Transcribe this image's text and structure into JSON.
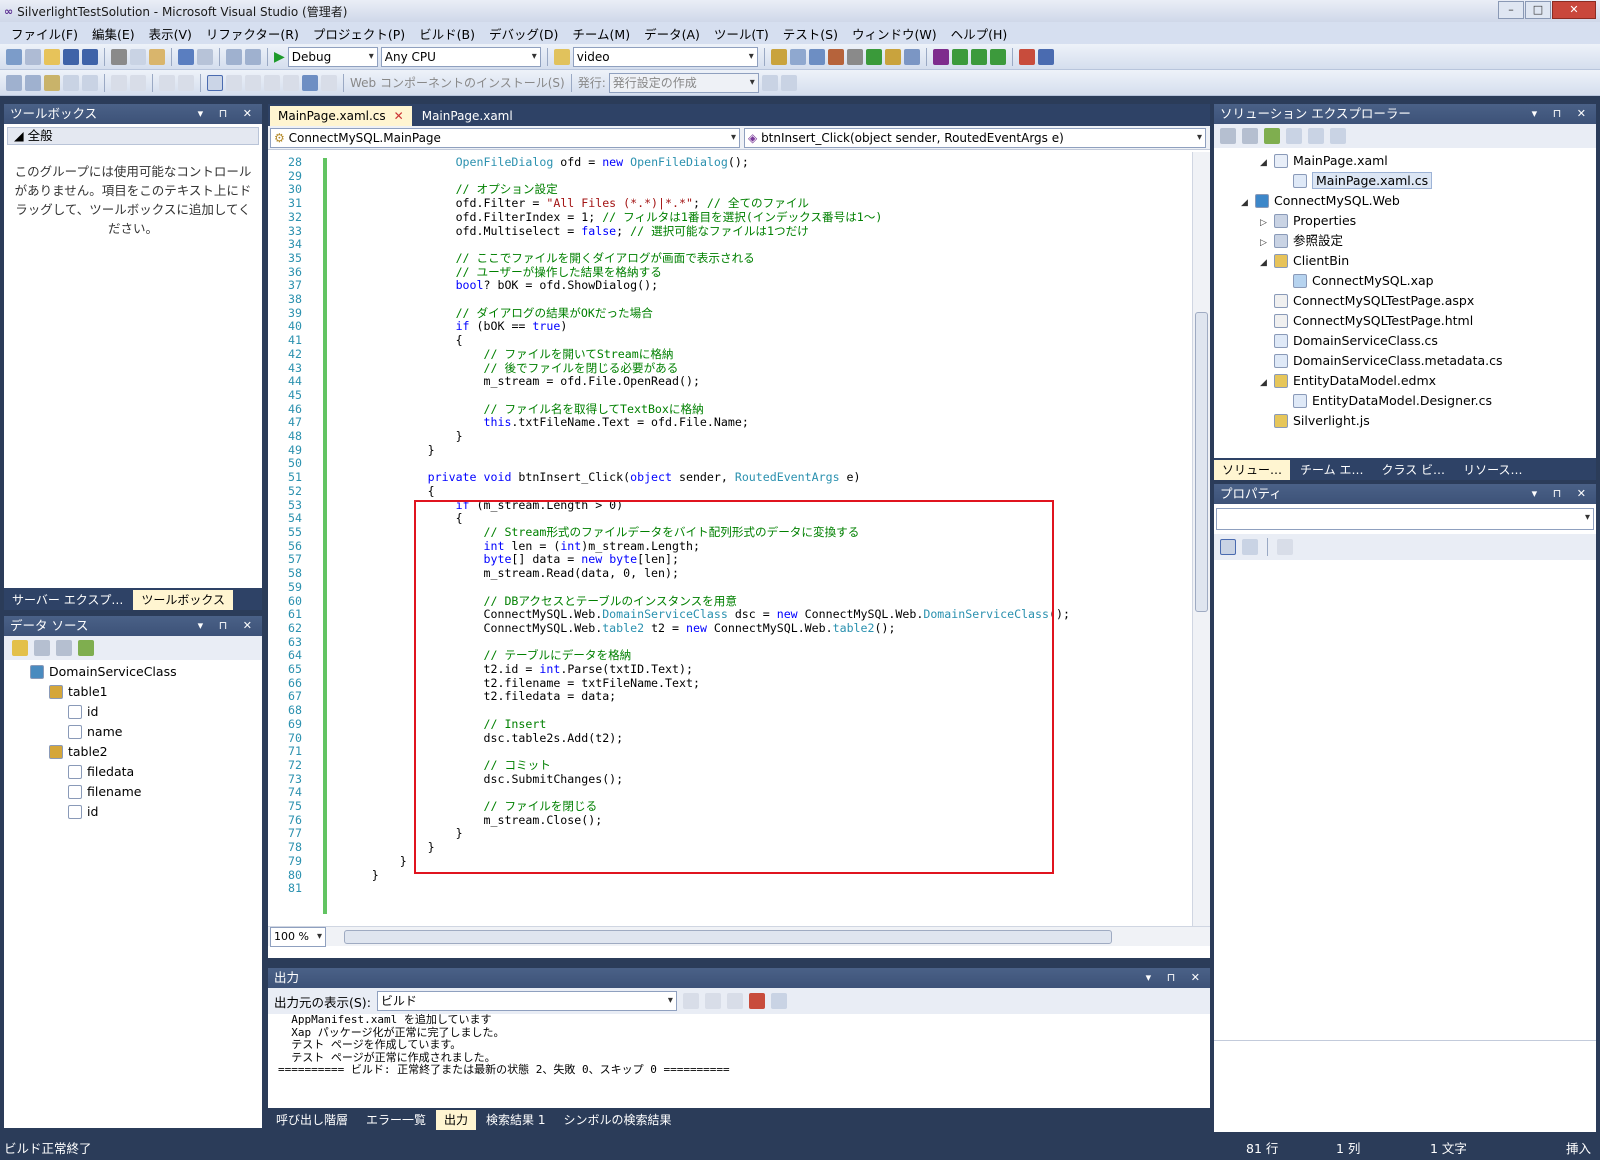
{
  "window": {
    "title": "SilverlightTestSolution - Microsoft Visual Studio (管理者)",
    "minimize": "–",
    "maximize": "□",
    "close": "✕"
  },
  "menu": [
    "ファイル(F)",
    "編集(E)",
    "表示(V)",
    "リファクター(R)",
    "プロジェクト(P)",
    "ビルド(B)",
    "デバッグ(D)",
    "チーム(M)",
    "データ(A)",
    "ツール(T)",
    "テスト(S)",
    "ウィンドウ(W)",
    "ヘルプ(H)"
  ],
  "toolbar": {
    "config": "Debug",
    "platform": "Any CPU",
    "find": "video",
    "web_install": "Web コンポーネントのインストール(S)",
    "publish_label": "発行:",
    "publish_value": "発行設定の作成"
  },
  "toolbox": {
    "title": "ツールボックス",
    "group": "全般",
    "message": "このグループには使用可能なコントロールがありません。項目をこのテキスト上にドラッグして、ツールボックスに追加してください。",
    "tabs": [
      "サーバー エクスプ…",
      "ツールボックス"
    ]
  },
  "datasource": {
    "title": "データ ソース",
    "items": [
      {
        "label": "DomainServiceClass",
        "level": 0,
        "icon": "database-icon"
      },
      {
        "label": "table1",
        "level": 1,
        "icon": "table-icon"
      },
      {
        "label": "id",
        "level": 2,
        "icon": "numeric-field-icon"
      },
      {
        "label": "name",
        "level": 2,
        "icon": "text-field-icon"
      },
      {
        "label": "table2",
        "level": 1,
        "icon": "table-icon"
      },
      {
        "label": "filedata",
        "level": 2,
        "icon": "binary-field-icon"
      },
      {
        "label": "filename",
        "level": 2,
        "icon": "text-field-icon"
      },
      {
        "label": "id",
        "level": 2,
        "icon": "numeric-field-icon"
      }
    ]
  },
  "editor": {
    "tabs": [
      {
        "label": "MainPage.xaml.cs",
        "active": true
      },
      {
        "label": "MainPage.xaml",
        "active": false
      }
    ],
    "class_combo": "ConnectMySQL.MainPage",
    "method_combo": "btnInsert_Click(object sender, RoutedEventArgs e)",
    "zoom": "100 %",
    "lines": [
      {
        "n": "28",
        "h": "                OpenFileDialog ofd = new OpenFileDialog();"
      },
      {
        "n": "29",
        "h": ""
      },
      {
        "n": "30",
        "h": "                // オプション設定"
      },
      {
        "n": "31",
        "h": "                ofd.Filter = \"All Files (*.*)|*.*\"; // 全てのファイル"
      },
      {
        "n": "32",
        "h": "                ofd.FilterIndex = 1; // フィルタは1番目を選択(インデックス番号は1～)"
      },
      {
        "n": "33",
        "h": "                ofd.Multiselect = false; // 選択可能なファイルは1つだけ"
      },
      {
        "n": "34",
        "h": ""
      },
      {
        "n": "35",
        "h": "                // ここでファイルを開くダイアログが画面で表示される"
      },
      {
        "n": "36",
        "h": "                // ユーザーが操作した結果を格納する"
      },
      {
        "n": "37",
        "h": "                bool? bOK = ofd.ShowDialog();"
      },
      {
        "n": "38",
        "h": ""
      },
      {
        "n": "39",
        "h": "                // ダイアログの結果がOKだった場合"
      },
      {
        "n": "40",
        "h": "                if (bOK == true)"
      },
      {
        "n": "41",
        "h": "                {"
      },
      {
        "n": "42",
        "h": "                    // ファイルを開いてStreamに格納"
      },
      {
        "n": "43",
        "h": "                    // 後でファイルを閉じる必要がある"
      },
      {
        "n": "44",
        "h": "                    m_stream = ofd.File.OpenRead();"
      },
      {
        "n": "45",
        "h": ""
      },
      {
        "n": "46",
        "h": "                    // ファイル名を取得してTextBoxに格納"
      },
      {
        "n": "47",
        "h": "                    this.txtFileName.Text = ofd.File.Name;"
      },
      {
        "n": "48",
        "h": "                }"
      },
      {
        "n": "49",
        "h": "            }"
      },
      {
        "n": "50",
        "h": ""
      },
      {
        "n": "51",
        "h": "            private void btnInsert_Click(object sender, RoutedEventArgs e)"
      },
      {
        "n": "52",
        "h": "            {"
      },
      {
        "n": "53",
        "h": "                if (m_stream.Length > 0)"
      },
      {
        "n": "54",
        "h": "                {"
      },
      {
        "n": "55",
        "h": "                    // Stream形式のファイルデータをバイト配列形式のデータに変換する"
      },
      {
        "n": "56",
        "h": "                    int len = (int)m_stream.Length;"
      },
      {
        "n": "57",
        "h": "                    byte[] data = new byte[len];"
      },
      {
        "n": "58",
        "h": "                    m_stream.Read(data, 0, len);"
      },
      {
        "n": "59",
        "h": ""
      },
      {
        "n": "60",
        "h": "                    // DBアクセスとテーブルのインスタンスを用意"
      },
      {
        "n": "61",
        "h": "                    ConnectMySQL.Web.DomainServiceClass dsc = new ConnectMySQL.Web.DomainServiceClass();"
      },
      {
        "n": "62",
        "h": "                    ConnectMySQL.Web.table2 t2 = new ConnectMySQL.Web.table2();"
      },
      {
        "n": "63",
        "h": ""
      },
      {
        "n": "64",
        "h": "                    // テーブルにデータを格納"
      },
      {
        "n": "65",
        "h": "                    t2.id = int.Parse(txtID.Text);"
      },
      {
        "n": "66",
        "h": "                    t2.filename = txtFileName.Text;"
      },
      {
        "n": "67",
        "h": "                    t2.filedata = data;"
      },
      {
        "n": "68",
        "h": ""
      },
      {
        "n": "69",
        "h": "                    // Insert"
      },
      {
        "n": "70",
        "h": "                    dsc.table2s.Add(t2);"
      },
      {
        "n": "71",
        "h": ""
      },
      {
        "n": "72",
        "h": "                    // コミット"
      },
      {
        "n": "73",
        "h": "                    dsc.SubmitChanges();"
      },
      {
        "n": "74",
        "h": ""
      },
      {
        "n": "75",
        "h": "                    // ファイルを閉じる"
      },
      {
        "n": "76",
        "h": "                    m_stream.Close();"
      },
      {
        "n": "77",
        "h": "                }"
      },
      {
        "n": "78",
        "h": "            }"
      },
      {
        "n": "79",
        "h": "        }"
      },
      {
        "n": "80",
        "h": "    }"
      },
      {
        "n": "81",
        "h": ""
      }
    ]
  },
  "solution": {
    "title": "ソリューション エクスプローラー",
    "items": [
      {
        "label": "MainPage.xaml",
        "level": 2,
        "exp": "◢",
        "icon": "xaml-file-icon"
      },
      {
        "label": "MainPage.xaml.cs",
        "level": 3,
        "exp": "",
        "icon": "cs-file-icon",
        "sel": true
      },
      {
        "label": "ConnectMySQL.Web",
        "level": 1,
        "exp": "◢",
        "icon": "web-project-icon"
      },
      {
        "label": "Properties",
        "level": 2,
        "exp": "▷",
        "icon": "properties-icon"
      },
      {
        "label": "参照設定",
        "level": 2,
        "exp": "▷",
        "icon": "references-icon"
      },
      {
        "label": "ClientBin",
        "level": 2,
        "exp": "◢",
        "icon": "folder-icon"
      },
      {
        "label": "ConnectMySQL.xap",
        "level": 3,
        "exp": "",
        "icon": "xap-file-icon"
      },
      {
        "label": "ConnectMySQLTestPage.aspx",
        "level": 2,
        "exp": "",
        "icon": "aspx-file-icon"
      },
      {
        "label": "ConnectMySQLTestPage.html",
        "level": 2,
        "exp": "",
        "icon": "html-file-icon"
      },
      {
        "label": "DomainServiceClass.cs",
        "level": 2,
        "exp": "",
        "icon": "cs-file-icon"
      },
      {
        "label": "DomainServiceClass.metadata.cs",
        "level": 2,
        "exp": "",
        "icon": "cs-file-icon"
      },
      {
        "label": "EntityDataModel.edmx",
        "level": 2,
        "exp": "◢",
        "icon": "edmx-file-icon"
      },
      {
        "label": "EntityDataModel.Designer.cs",
        "level": 3,
        "exp": "",
        "icon": "cs-file-icon"
      },
      {
        "label": "Silverlight.js",
        "level": 2,
        "exp": "",
        "icon": "js-file-icon"
      }
    ],
    "tabs": [
      "ソリュー…",
      "チーム エ…",
      "クラス ビ…",
      "リソース…"
    ]
  },
  "properties": {
    "title": "プロパティ"
  },
  "output": {
    "title": "出力",
    "source_label": "出力元の表示(S):",
    "source_value": "ビルド",
    "lines": [
      "  AppManifest.xaml を追加しています",
      "  Xap パッケージ化が正常に完了しました。",
      "  テスト ページを作成しています。",
      "  テスト ページが正常に作成されました。",
      "========== ビルド: 正常終了または最新の状態 2、失敗 0、スキップ 0 =========="
    ],
    "tabs": [
      "呼び出し階層",
      "エラー一覧",
      "出力",
      "検索結果 1",
      "シンボルの検索結果"
    ]
  },
  "status": {
    "message": "ビルド正常終了",
    "line": "81 行",
    "col": "1 列",
    "char": "1 文字",
    "mode": "挿入"
  },
  "colors": {
    "frame": "#2b3c59",
    "highlight_box": "#e0141f",
    "keyword": "#0000ff",
    "comment": "#008000",
    "type": "#2b91af"
  }
}
